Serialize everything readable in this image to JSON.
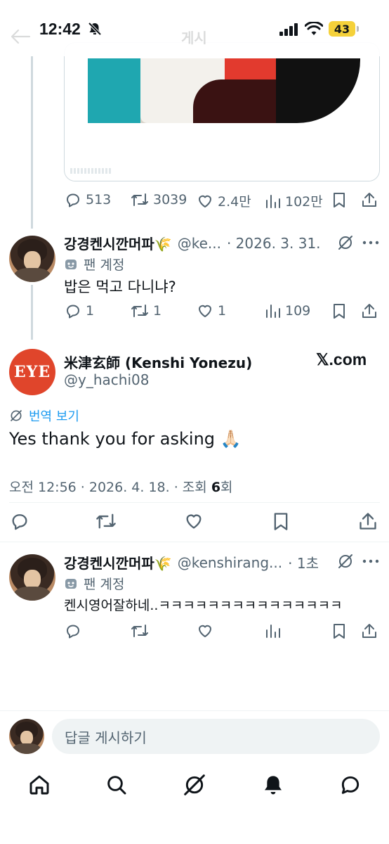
{
  "status_bar": {
    "time": "12:42",
    "battery": "43"
  },
  "header": {
    "title": "게시"
  },
  "quoted_post": {
    "actions": {
      "replies": "513",
      "reposts": "3039",
      "likes": "2.4만",
      "views": "102만"
    }
  },
  "reply_1": {
    "name": "강경켄시깐머파🌾",
    "handle": "@ke...",
    "date": "· 2026. 3. 31.",
    "fan_label": "팬 계정",
    "text": "밥은 먹고 다니냐?",
    "actions": {
      "replies": "1",
      "reposts": "1",
      "likes": "1",
      "views": "109"
    }
  },
  "main_post": {
    "avatar_text": "EYE",
    "name": "米津玄師 (Kenshi Yonezu)",
    "handle": "@y_hachi08",
    "x_badge": "𝕏.com",
    "translate": "번역 보기",
    "text": "Yes thank you for asking 🙏🏻",
    "timestamp": "오전 12:56 · 2026. 4. 18. · 조회 ",
    "views": "6",
    "views_suffix": "회"
  },
  "reply_2": {
    "name": "강경켄시깐머파🌾",
    "handle": "@kenshirang...",
    "date": "· 1초",
    "fan_label": "팬 계정",
    "text": "켄시영어잘하네..ㅋㅋㅋㅋㅋㅋㅋㅋㅋㅋㅋㅋㅋㅋㅋ"
  },
  "reply_box": {
    "placeholder": "답글 게시하기"
  },
  "colors": {
    "accent": "#1d9bf0",
    "secondary_text": "#536471",
    "primary_text": "#0f1419",
    "eye_red": "#e0452b",
    "battery": "#f5d13a"
  }
}
